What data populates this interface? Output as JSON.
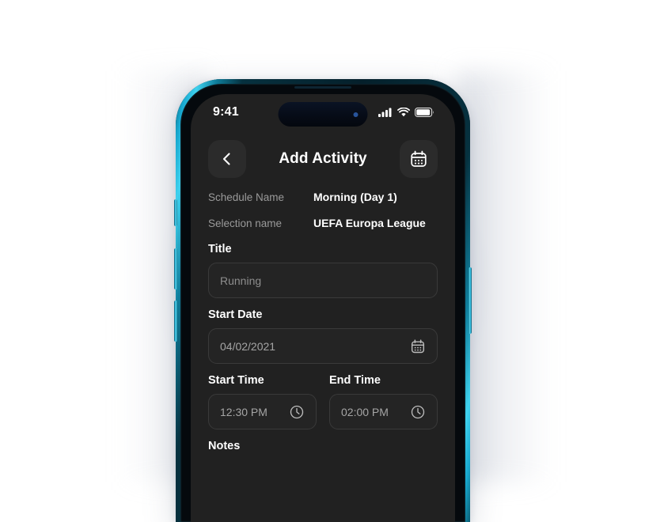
{
  "device": {
    "frame_color": "#3fd2ef",
    "screen_bg": "#212121",
    "buttons": [
      "mute-switch",
      "volume-up",
      "volume-down",
      "power"
    ]
  },
  "status_bar": {
    "time": "9:41",
    "icons": [
      "cellular-signal-icon",
      "wifi-icon",
      "battery-icon"
    ],
    "battery_level": 85
  },
  "app_bar": {
    "back_icon": "chevron-left-icon",
    "title": "Add Activity",
    "action_icon": "calendar-icon"
  },
  "meta": [
    {
      "label": "Schedule Name",
      "value": "Morning (Day 1)"
    },
    {
      "label": "Selection name",
      "value": "UEFA Europa League"
    }
  ],
  "form": {
    "title": {
      "label": "Title",
      "value": "Running",
      "placeholder": "Running"
    },
    "start_date": {
      "label": "Start Date",
      "value": "04/02/2021",
      "icon": "calendar-icon"
    },
    "start_time": {
      "label": "Start Time",
      "value": "12:30 PM",
      "icon": "clock-icon"
    },
    "end_time": {
      "label": "End Time",
      "value": "02:00 PM",
      "icon": "clock-icon"
    },
    "notes": {
      "label": "Notes"
    }
  }
}
